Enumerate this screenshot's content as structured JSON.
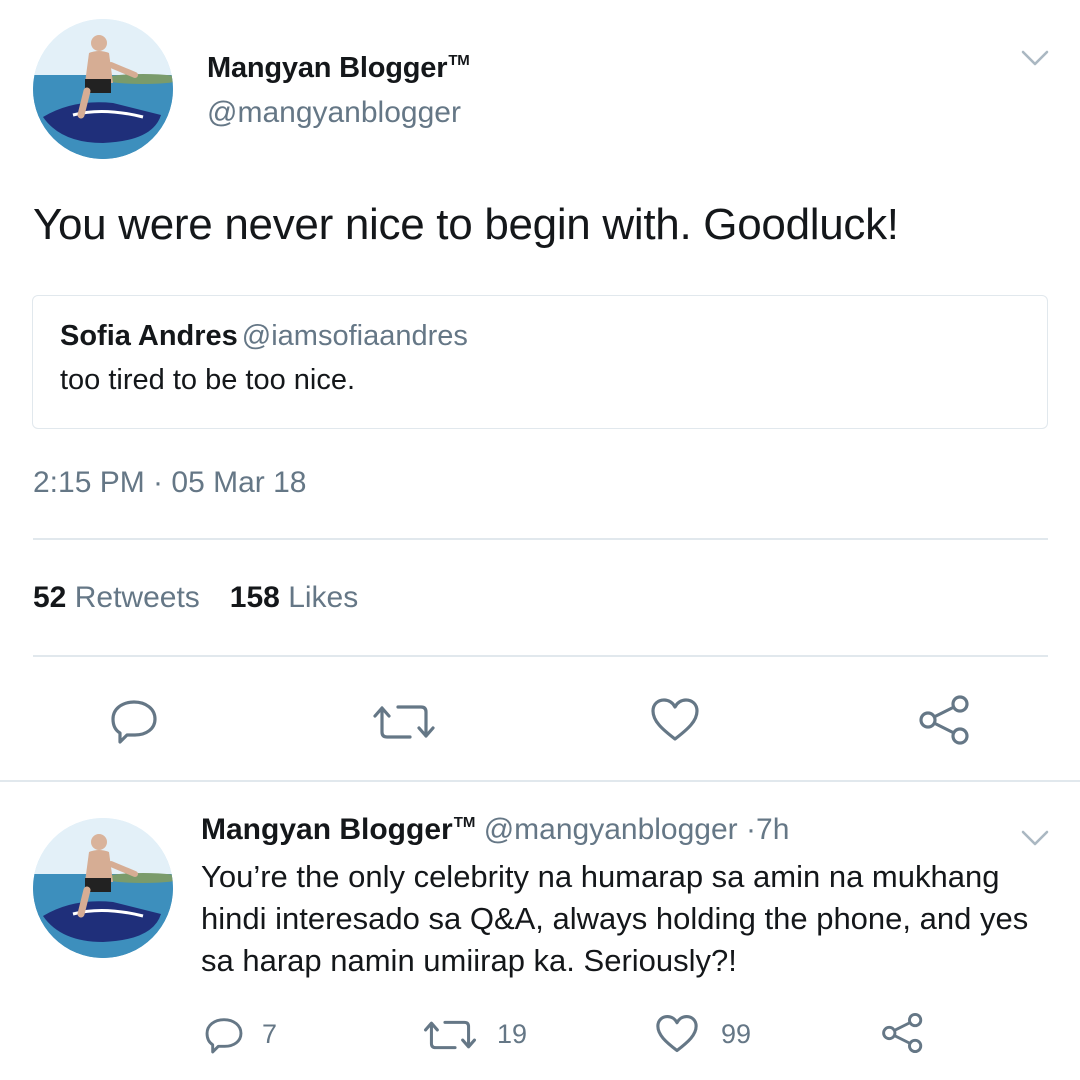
{
  "tweet": {
    "author_name": "Mangyan Blogger",
    "author_tm": "TM",
    "author_handle": "@mangyanblogger",
    "text": "You were never nice to begin with. Goodluck!",
    "quoted": {
      "name": "Sofia Andres",
      "handle": "@iamsofiaandres",
      "text": "too tired to be too nice."
    },
    "timestamp": "2:15 PM · 05 Mar 18",
    "retweet_count": "52",
    "retweet_label": "Retweets",
    "like_count": "158",
    "like_label": "Likes"
  },
  "reply": {
    "author_name": "Mangyan Blogger",
    "author_tm": "TM",
    "author_handle": "@mangyanblogger",
    "separator": "·",
    "age": "7h",
    "text": "You’re the only celebrity na humarap sa amin na mukhang hindi interesado sa Q&A, always holding the phone, and yes sa harap namin umiirap ka. Seriously?!",
    "reply_count": "7",
    "retweet_count": "19",
    "like_count": "99"
  },
  "icons": {
    "menu": "chevron-down-icon",
    "reply": "reply-bubble-icon",
    "retweet": "retweet-icon",
    "like": "heart-icon",
    "share": "share-icon"
  },
  "colors": {
    "text_primary": "#14171a",
    "text_secondary": "#657786",
    "border": "#e1e8ed"
  }
}
